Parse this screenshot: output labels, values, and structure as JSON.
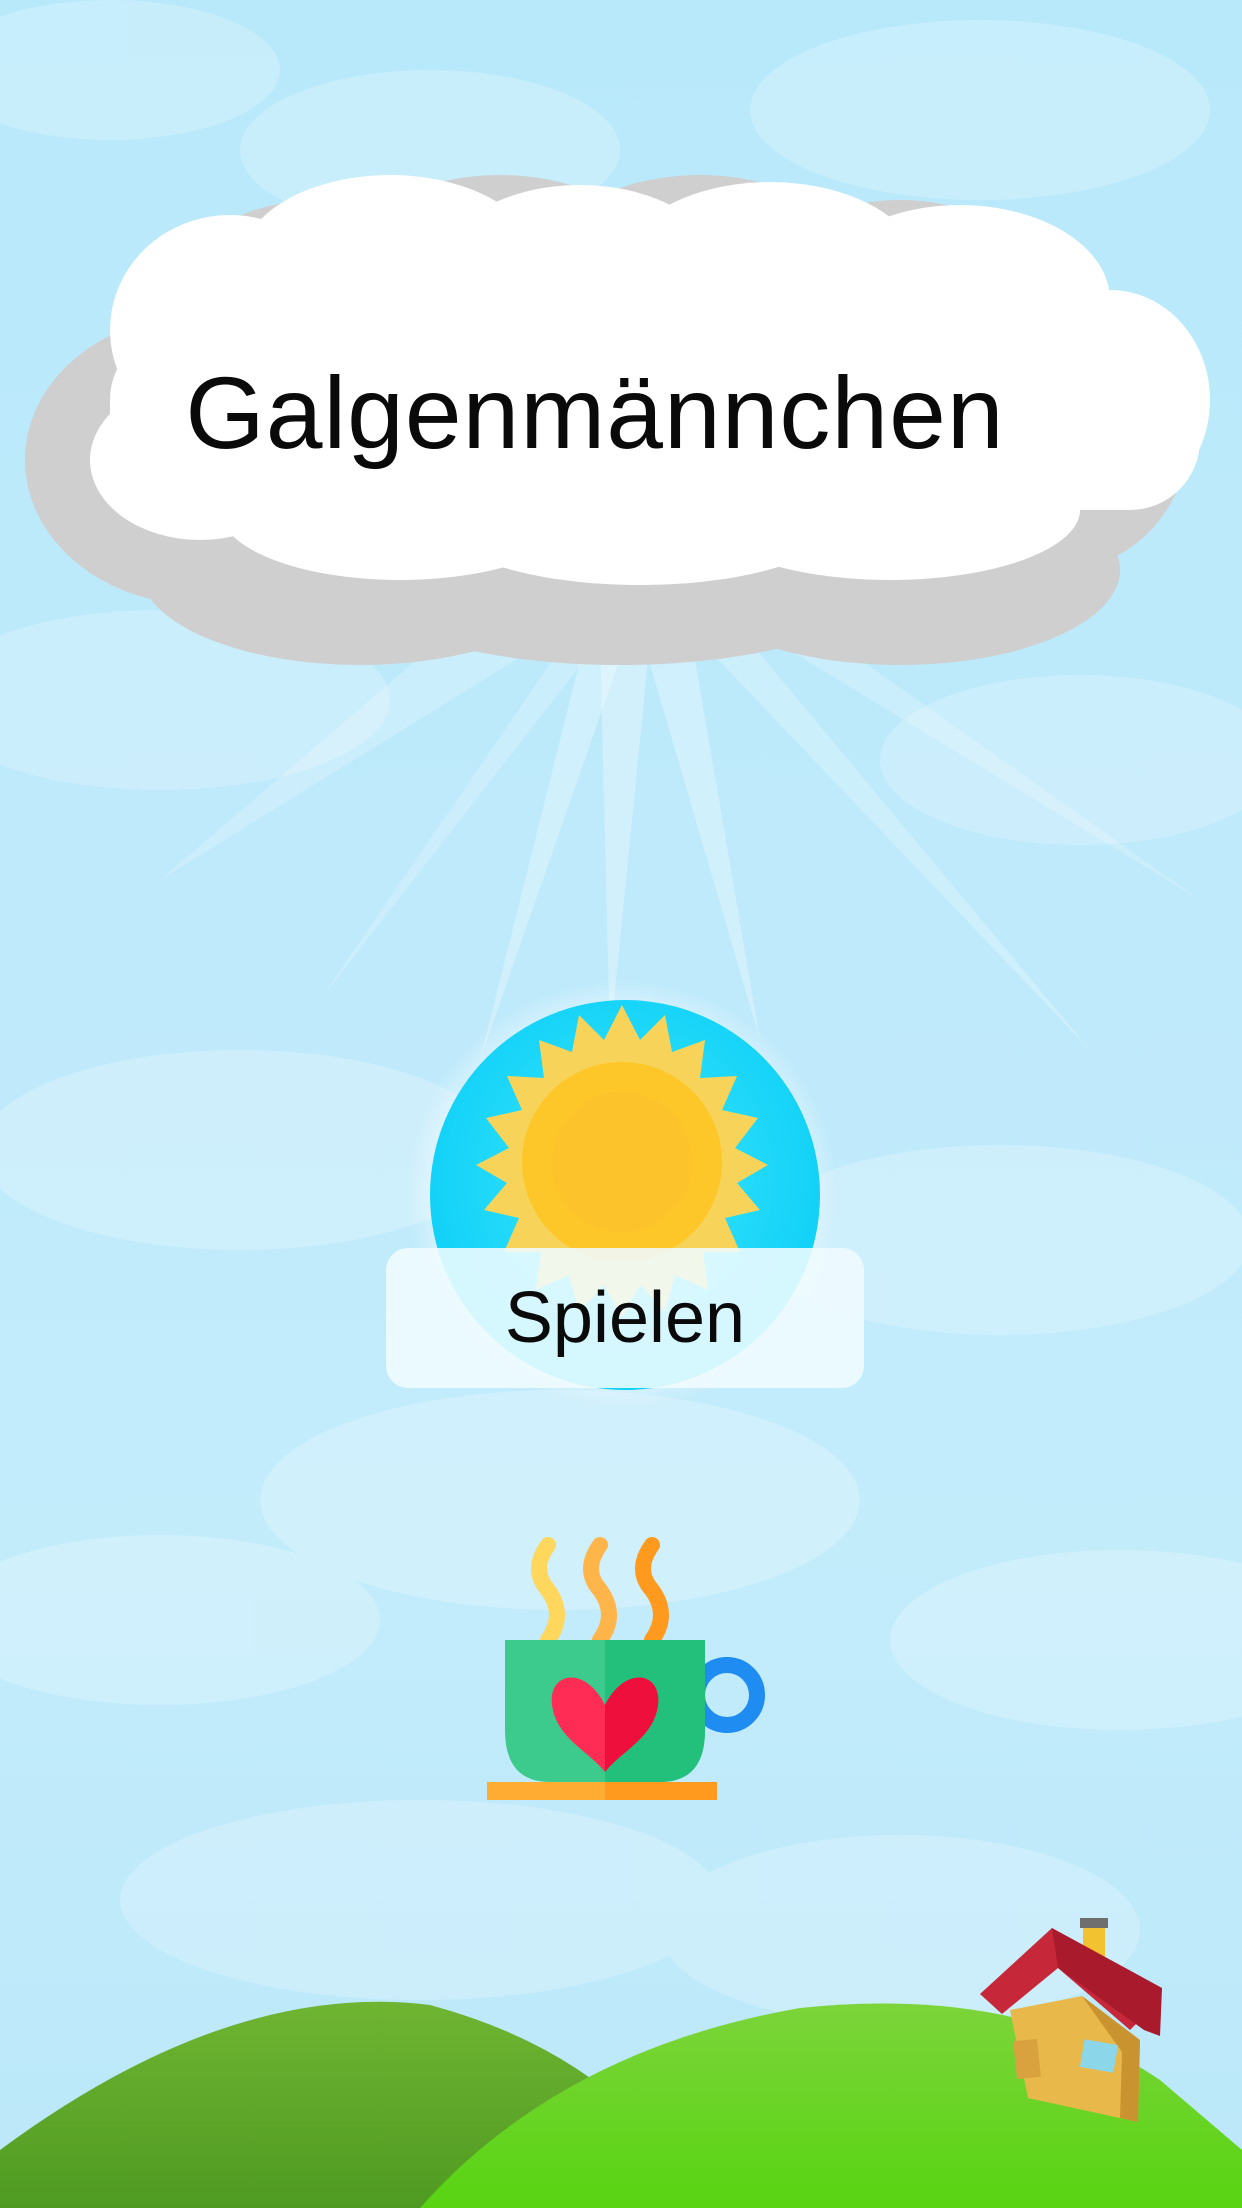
{
  "title": "Galgenmännchen",
  "play_button": {
    "label": "Spielen",
    "icon": "sun-icon"
  },
  "support_button": {
    "icon": "coffee-cup-heart-icon"
  },
  "scenery": {
    "house": "house-icon",
    "hills": "green-hills"
  },
  "colors": {
    "sky": "#b8e9fb",
    "cloud": "#ffffff",
    "cloud_shadow": "#cfcfcf",
    "sun": "#fdc72a",
    "sun_ray": "#f7d35a",
    "orb": "#16d8fa",
    "hill_dark": "#5fae2c",
    "hill_light": "#63d31f",
    "cup": "#3ccb8c",
    "heart": "#ff2d55",
    "saucer": "#ffac33",
    "handle": "#1e8cf0"
  }
}
